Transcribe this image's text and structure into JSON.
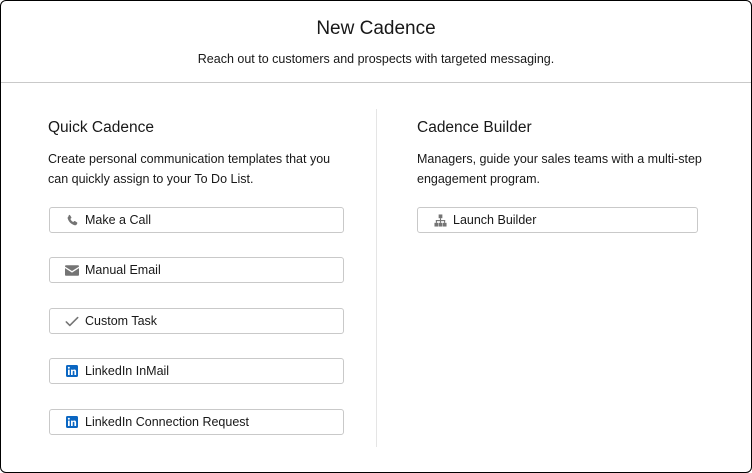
{
  "header": {
    "title": "New Cadence",
    "subtitle": "Reach out to customers and prospects with targeted messaging."
  },
  "quick_cadence": {
    "title": "Quick Cadence",
    "description": "Create personal communication templates that you can quickly assign to your To Do List.",
    "buttons": [
      {
        "label": "Make a Call",
        "icon": "phone-icon"
      },
      {
        "label": "Manual Email",
        "icon": "email-icon"
      },
      {
        "label": "Custom Task",
        "icon": "check-icon"
      },
      {
        "label": "LinkedIn InMail",
        "icon": "linkedin-icon"
      },
      {
        "label": "LinkedIn Connection Request",
        "icon": "linkedin-icon"
      }
    ]
  },
  "cadence_builder": {
    "title": "Cadence Builder",
    "description": "Managers, guide your sales teams with a multi-step engagement program.",
    "buttons": [
      {
        "label": "Launch Builder",
        "icon": "hierarchy-icon"
      }
    ]
  },
  "colors": {
    "icon_gray": "#747474",
    "linkedin_blue": "#0a66c2",
    "border": "#c9c9c9"
  }
}
